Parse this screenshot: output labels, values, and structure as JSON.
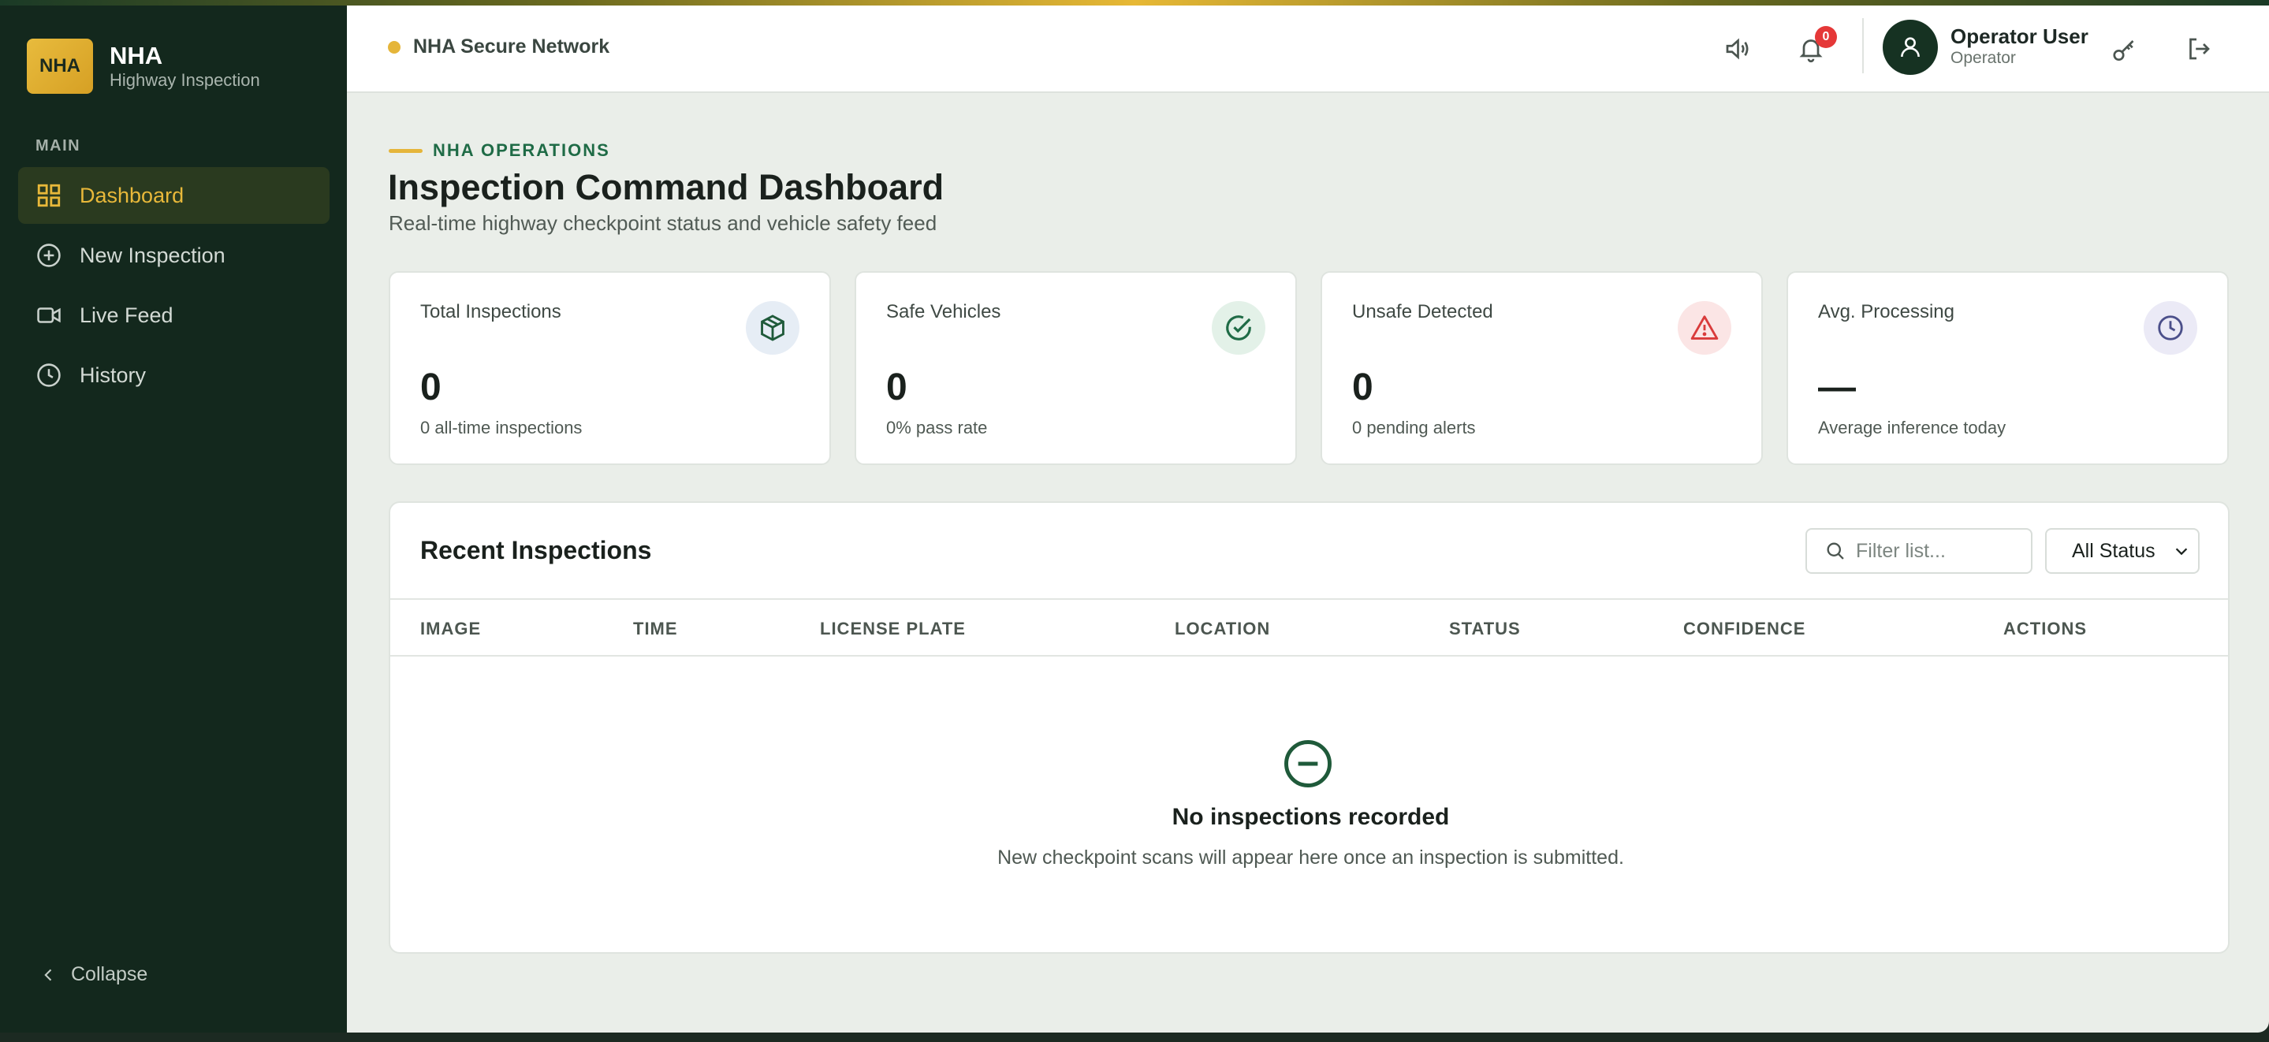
{
  "brand": {
    "logo": "NHA",
    "name": "NHA",
    "subtitle": "Highway Inspection"
  },
  "sidebar": {
    "section": "MAIN",
    "items": [
      {
        "label": "Dashboard",
        "icon": "grid-icon",
        "active": true
      },
      {
        "label": "New Inspection",
        "icon": "plus-circle-icon",
        "active": false
      },
      {
        "label": "Live Feed",
        "icon": "video-icon",
        "active": false
      },
      {
        "label": "History",
        "icon": "clock-icon",
        "active": false
      }
    ],
    "collapse_label": "Collapse"
  },
  "header": {
    "network_label": "NHA Secure Network",
    "notification_count": "0",
    "user_name": "Operator User",
    "user_role": "Operator"
  },
  "main": {
    "eyebrow": "NHA OPERATIONS",
    "title": "Inspection Command Dashboard",
    "subtitle": "Real-time highway checkpoint status and vehicle safety feed"
  },
  "stats": [
    {
      "title": "Total Inspections",
      "value": "0",
      "note": "0 all-time inspections",
      "icon": "package-icon",
      "color": "#1f5a3a",
      "bg": "#e6edf5"
    },
    {
      "title": "Safe Vehicles",
      "value": "0",
      "note": "0% pass rate",
      "icon": "check-circle-icon",
      "color": "#1f6b46",
      "bg": "#e3f1e8"
    },
    {
      "title": "Unsafe Detected",
      "value": "0",
      "note": "0 pending alerts",
      "icon": "alert-triangle-icon",
      "color": "#d93b3b",
      "bg": "#fbe5e5"
    },
    {
      "title": "Avg. Processing",
      "value": "—",
      "note": "Average inference today",
      "icon": "clock-icon",
      "color": "#4b4f8a",
      "bg": "#ebeaf6"
    }
  ],
  "recent": {
    "title": "Recent Inspections",
    "search_placeholder": "Filter list...",
    "status_filter": "All Status",
    "columns": [
      "IMAGE",
      "TIME",
      "LICENSE PLATE",
      "LOCATION",
      "STATUS",
      "CONFIDENCE",
      "ACTIONS"
    ],
    "empty_title": "No inspections recorded",
    "empty_subtitle": "New checkpoint scans will appear here once an inspection is submitted."
  }
}
